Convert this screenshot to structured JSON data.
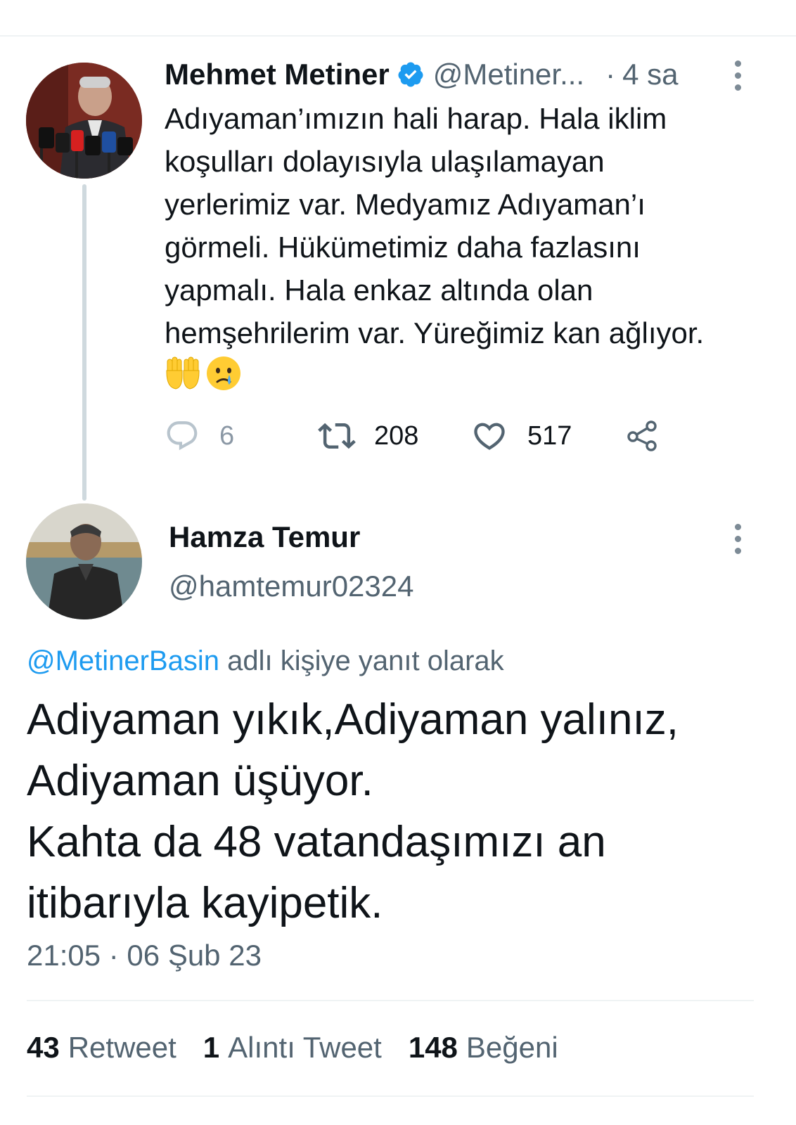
{
  "tweet1": {
    "author_name": "Mehmet Metiner",
    "handle": "@Metiner...",
    "dot": "·",
    "time": "4 sa",
    "text": "Adıyaman’ımızın hali harap. Hala iklim\nkoşulları dolayısıyla ulaşılamayan\nyerlerimiz var. Medyamız Adıyaman’ı\ngörmeli. Hükümetimiz daha fazlasını\nyapmalı. Hala enkaz altında olan\nhemşehrilerim var. Yüreğimiz kan ağlıyor.",
    "emojis": [
      "raised-hands-icon",
      "crying-face-icon"
    ],
    "reply_count": "6",
    "retweet_count": "208",
    "like_count": "517"
  },
  "tweet2": {
    "author_name": "Hamza Temur",
    "handle": "@hamtemur02324",
    "reply_to_mention": "@MetinerBasin",
    "reply_to_suffix": " adlı kişiye yanıt olarak",
    "text": "Adiyaman yıkık,Adiyaman yalınız,\nAdiyaman üşüyor.\nKahta da 48 vatandaşımızı an\nitibarıyla kayipetik.",
    "timestamp": "21:05 · 06 Şub 23"
  },
  "stats": {
    "retweets_num": "43",
    "retweets_label": "Retweet",
    "quotes_num": "1",
    "quotes_label": "Alıntı Tweet",
    "likes_num": "148",
    "likes_label": "Beğeni"
  },
  "colors": {
    "verified": "#1d9bf0",
    "secondary_text": "#536471",
    "mention": "#1d9bf0",
    "divider": "#eff3f4"
  }
}
